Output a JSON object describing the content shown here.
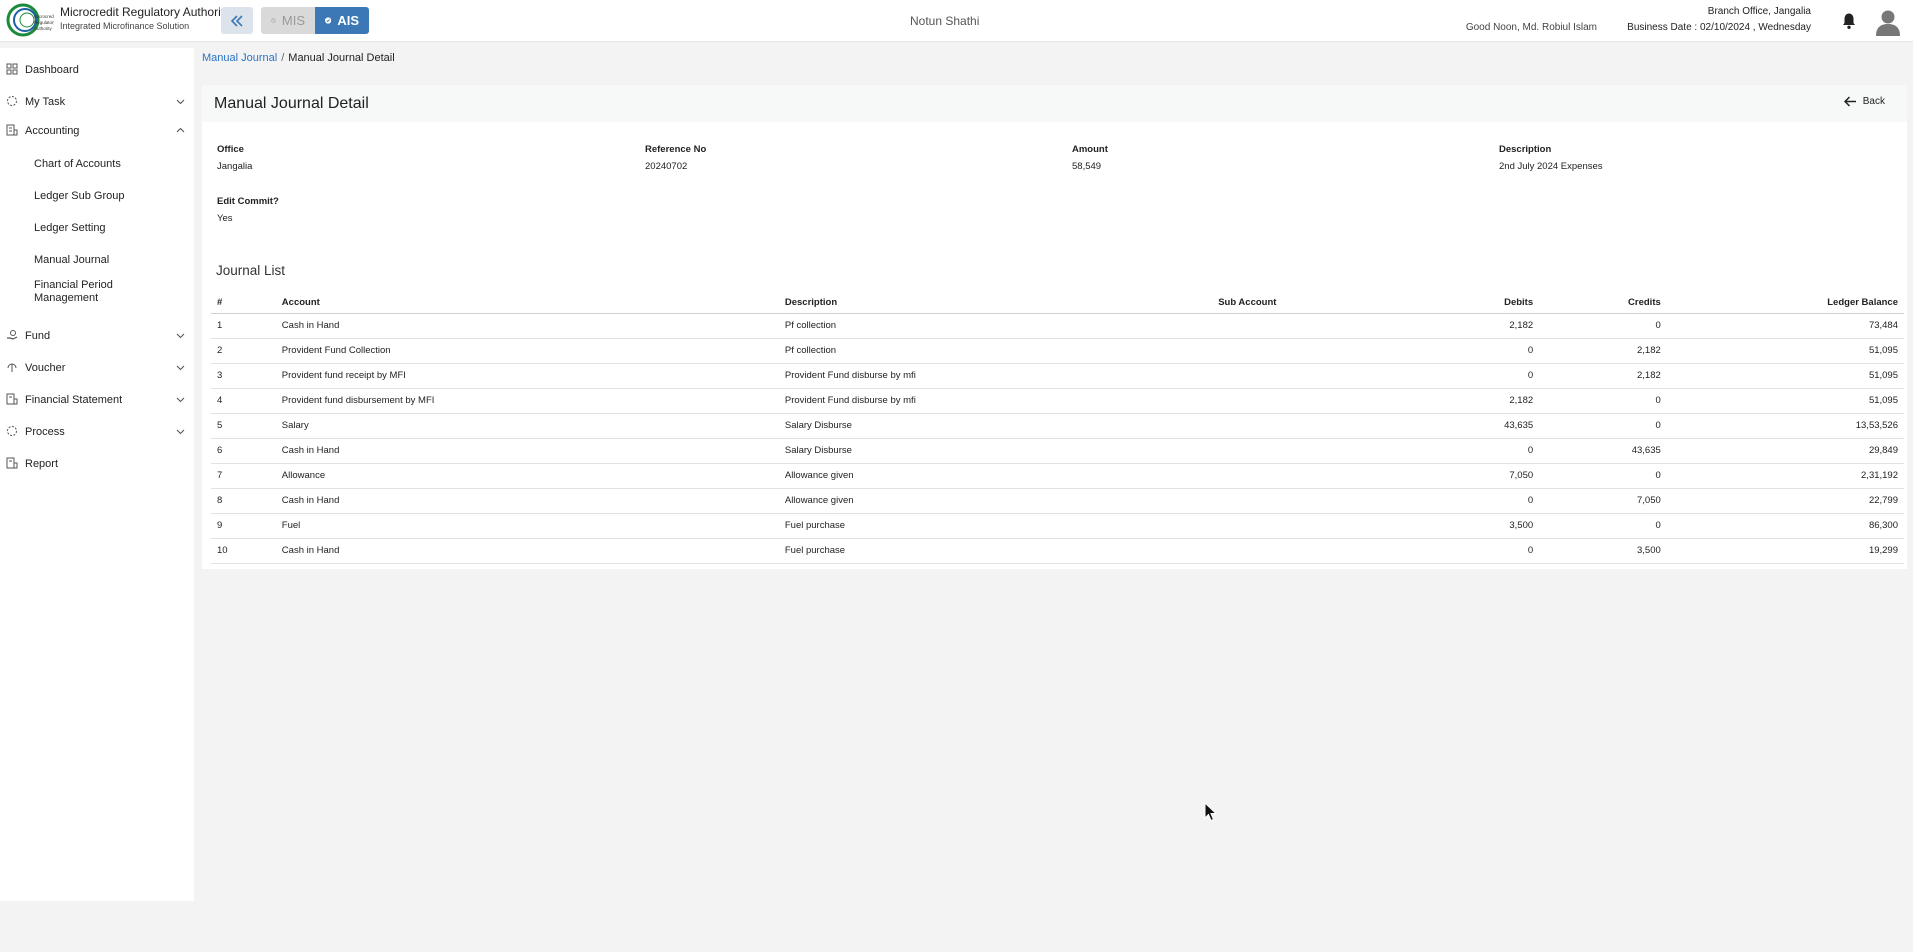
{
  "header": {
    "brand_title": "Microcredit Regulatory Authority",
    "brand_subtitle": "Integrated Microfinance Solution",
    "logo_text": "Microcredit Regulatory Authority",
    "mode_mis": "MIS",
    "mode_ais": "AIS",
    "org_name": "Notun Shathi",
    "greeting": "Good Noon, Md. Robiul Islam",
    "branch": "Branch Office, Jangalia",
    "business_date": "Business Date : 02/10/2024 , Wednesday",
    "accent_color": "#3b78b5"
  },
  "sidebar": {
    "dashboard": "Dashboard",
    "my_task": "My Task",
    "accounting": "Accounting",
    "accounting_items": [
      "Chart of Accounts",
      "Ledger Sub Group",
      "Ledger Setting",
      "Manual Journal",
      "Financial Period Management"
    ],
    "fund": "Fund",
    "voucher": "Voucher",
    "financial_statement": "Financial Statement",
    "process": "Process",
    "report": "Report"
  },
  "breadcrumb": {
    "parent": "Manual Journal",
    "separator": "/",
    "current": "Manual Journal Detail"
  },
  "detail": {
    "title": "Manual Journal Detail",
    "back_label": "Back",
    "office_label": "Office",
    "office_value": "Jangalia",
    "reference_label": "Reference No",
    "reference_value": "20240702",
    "amount_label": "Amount",
    "amount_value": "58,549",
    "description_label": "Description",
    "description_value": "2nd July 2024 Expenses",
    "edit_commit_label": "Edit Commit?",
    "edit_commit_value": "Yes"
  },
  "journal": {
    "title": "Journal List",
    "columns": [
      "#",
      "Account",
      "Description",
      "Sub Account",
      "Debits",
      "Credits",
      "Ledger Balance"
    ],
    "rows": [
      {
        "idx": "1",
        "account": "Cash in Hand",
        "description": "Pf collection",
        "sub_account": "",
        "debits": "2,182",
        "credits": "0",
        "balance": "73,484"
      },
      {
        "idx": "2",
        "account": "Provident Fund Collection",
        "description": "Pf collection",
        "sub_account": "",
        "debits": "0",
        "credits": "2,182",
        "balance": "51,095"
      },
      {
        "idx": "3",
        "account": "Provident fund receipt by MFI",
        "description": "Provident Fund disburse by mfi",
        "sub_account": "",
        "debits": "0",
        "credits": "2,182",
        "balance": "51,095"
      },
      {
        "idx": "4",
        "account": "Provident fund disbursement by MFI",
        "description": "Provident Fund disburse by mfi",
        "sub_account": "",
        "debits": "2,182",
        "credits": "0",
        "balance": "51,095"
      },
      {
        "idx": "5",
        "account": "Salary",
        "description": "Salary Disburse",
        "sub_account": "",
        "debits": "43,635",
        "credits": "0",
        "balance": "13,53,526"
      },
      {
        "idx": "6",
        "account": "Cash in Hand",
        "description": "Salary Disburse",
        "sub_account": "",
        "debits": "0",
        "credits": "43,635",
        "balance": "29,849"
      },
      {
        "idx": "7",
        "account": "Allowance",
        "description": "Allowance given",
        "sub_account": "",
        "debits": "7,050",
        "credits": "0",
        "balance": "2,31,192"
      },
      {
        "idx": "8",
        "account": "Cash in Hand",
        "description": "Allowance given",
        "sub_account": "",
        "debits": "0",
        "credits": "7,050",
        "balance": "22,799"
      },
      {
        "idx": "9",
        "account": "Fuel",
        "description": "Fuel purchase",
        "sub_account": "",
        "debits": "3,500",
        "credits": "0",
        "balance": "86,300"
      },
      {
        "idx": "10",
        "account": "Cash in Hand",
        "description": "Fuel purchase",
        "sub_account": "",
        "debits": "0",
        "credits": "3,500",
        "balance": "19,299"
      }
    ]
  }
}
